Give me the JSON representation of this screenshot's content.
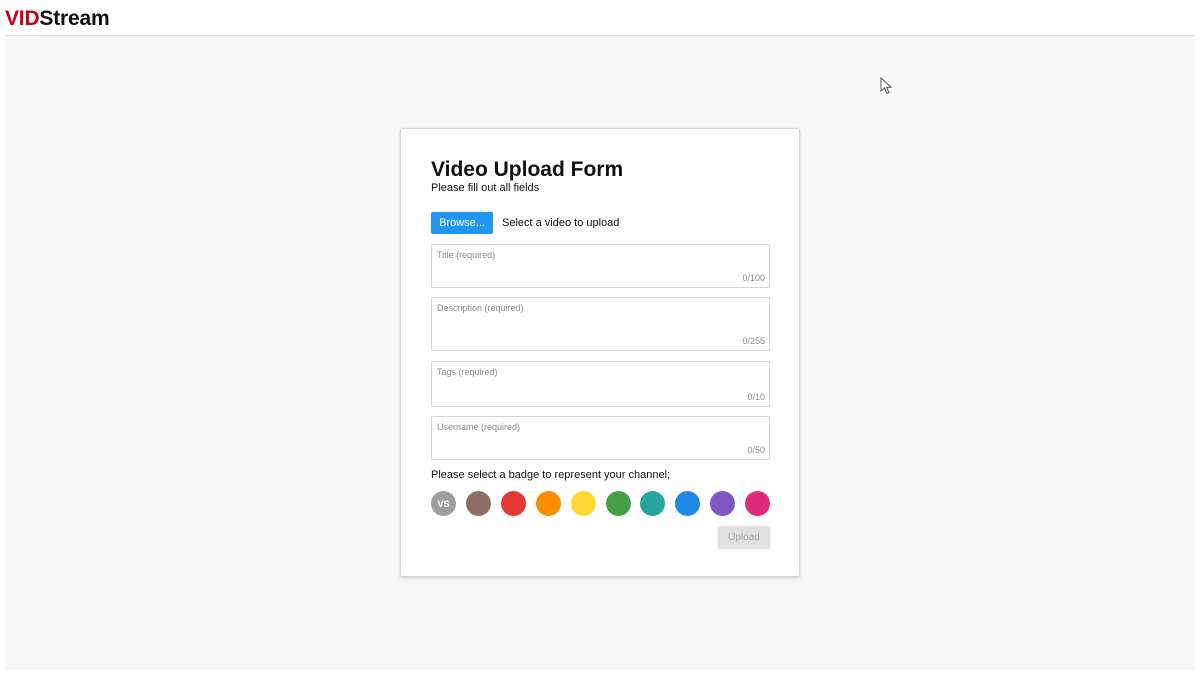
{
  "header": {
    "logo_red": "VID",
    "logo_black": "Stream"
  },
  "form": {
    "title": "Video Upload Form",
    "subtitle": "Please fill out all fields",
    "browse_label": "Browse...",
    "browse_hint": "Select a video to upload",
    "fields": {
      "title": {
        "placeholder": "Title (required)",
        "counter": "0/100"
      },
      "description": {
        "placeholder": "Description (required)",
        "counter": "0/255"
      },
      "tags": {
        "placeholder": "Tags (required)",
        "counter": "0/10"
      },
      "username": {
        "placeholder": "Username (required)",
        "counter": "0/50"
      }
    },
    "badge_prompt": "Please select a badge to represent your channel;",
    "badges": [
      {
        "color": "#9e9e9e",
        "text": "VS"
      },
      {
        "color": "#8d6e63",
        "text": ""
      },
      {
        "color": "#e53935",
        "text": ""
      },
      {
        "color": "#fb8c00",
        "text": ""
      },
      {
        "color": "#fdd835",
        "text": ""
      },
      {
        "color": "#43a047",
        "text": ""
      },
      {
        "color": "#26a69a",
        "text": ""
      },
      {
        "color": "#1e88e5",
        "text": ""
      },
      {
        "color": "#7e57c2",
        "text": ""
      },
      {
        "color": "#e0297a",
        "text": ""
      }
    ],
    "upload_label": "Upload"
  },
  "colors": {
    "accent": "#2196f3",
    "brand_red": "#c4001a"
  },
  "icons": {
    "cursor": "mouse-pointer-icon"
  }
}
